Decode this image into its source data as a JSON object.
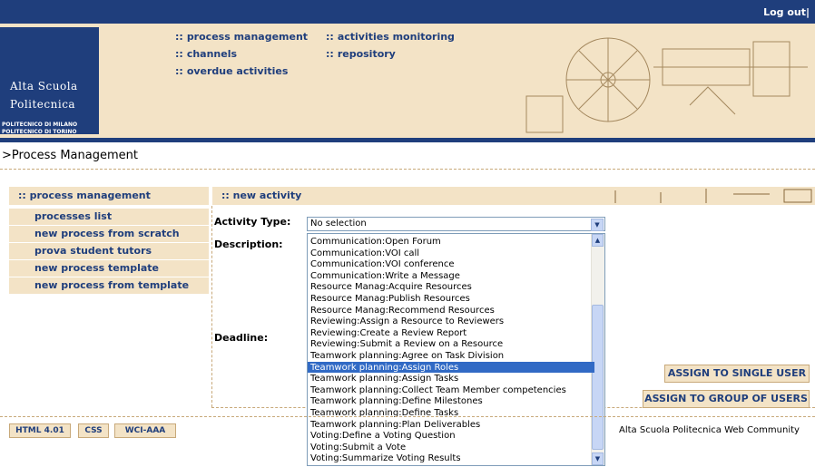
{
  "topbar": {
    "logout": "Log out|"
  },
  "logo": {
    "line1": "Alta Scuola",
    "line2": "Politecnica",
    "line3": "POLITECNICO DI MILANO",
    "line4": "POLITECNICO DI TORINO"
  },
  "nav": {
    "bullet": "::",
    "process_management": "process management",
    "activities_monitoring": "activities monitoring",
    "channels": "channels",
    "repository": "repository",
    "overdue_activities": "overdue activities"
  },
  "breadcrumb": ">Process Management",
  "sidebar": {
    "title": ":: process management",
    "items": [
      "processes list",
      "new process from scratch",
      "prova student tutors",
      "new process template",
      "new process from template"
    ]
  },
  "content": {
    "title": ":: new activity",
    "activity_type_label": "Activity Type:",
    "description_label": "Description:",
    "deadline_label": "Deadline:",
    "select_value": "No selection",
    "options": [
      "Communication:Open Forum",
      "Communication:VOI call",
      "Communication:VOI conference",
      "Communication:Write a Message",
      "Resource Manag:Acquire Resources",
      "Resource Manag:Publish Resources",
      "Resource Manag:Recommend Resources",
      "Reviewing:Assign a Resource to Reviewers",
      "Reviewing:Create a Review Report",
      "Reviewing:Submit a Review on a Resource",
      "Teamwork planning:Agree on Task Division",
      "Teamwork planning:Assign Roles",
      "Teamwork planning:Assign Tasks",
      "Teamwork planning:Collect Team Member competencies",
      "Teamwork planning:Define Milestones",
      "Teamwork planning:Define Tasks",
      "Teamwork planning:Plan Deliverables",
      "Voting:Define a Voting Question",
      "Voting:Submit a Vote",
      "Voting:Summarize Voting Results"
    ],
    "selected_option": "Teamwork planning:Assign Roles",
    "assign_single": "ASSIGN TO SINGLE USER",
    "assign_group": "ASSIGN TO GROUP OF USERS"
  },
  "footer": {
    "badges": [
      "HTML 4.01",
      "CSS",
      "WCI-AAA"
    ],
    "text": "Alta Scuola Politecnica Web Community"
  },
  "colors": {
    "brand_blue": "#1f3e7c",
    "beige": "#f3e3c6",
    "selection": "#316ac5"
  }
}
